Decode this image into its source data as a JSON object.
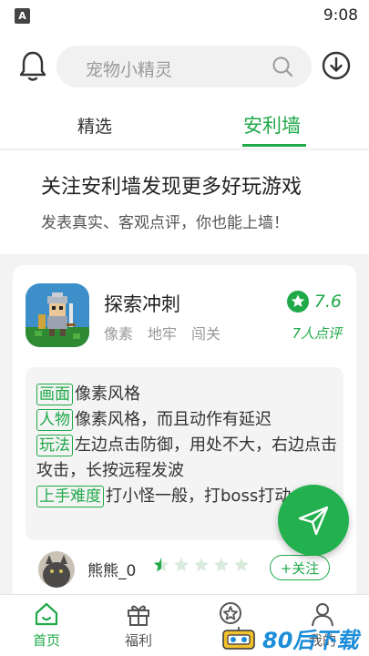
{
  "status_bar": {
    "app_icon_letter": "A",
    "time": "9:08"
  },
  "header": {
    "search_placeholder": "宠物小精灵"
  },
  "tabs": [
    {
      "label": "精选",
      "active": false
    },
    {
      "label": "安利墙",
      "active": true
    }
  ],
  "banner": {
    "title": "关注安利墙发现更多好玩游戏",
    "subtitle": "发表真实、客观点评，你也能上墙！"
  },
  "game": {
    "name": "探索冲刺",
    "tags": [
      "像素",
      "地牢",
      "闯关"
    ],
    "score": "7.6",
    "review_count": "7人点评"
  },
  "review": {
    "items": [
      {
        "tag": "画面",
        "text": "像素风格"
      },
      {
        "tag": "人物",
        "text": "像素风格，而且动作有延迟"
      },
      {
        "tag": "玩法",
        "text": "左边点击防御，用处不大，右边点击攻击，长按远程发波"
      },
      {
        "tag": "上手难度",
        "text": "打小怪一般，打boss打动..."
      }
    ],
    "reviewer_name": "熊熊_0",
    "reviewer_stars": 0.5,
    "follow_label": "+关注"
  },
  "bottom_nav": [
    {
      "label": "首页",
      "icon": "home-icon",
      "active": true
    },
    {
      "label": "福利",
      "icon": "gift-icon",
      "active": false
    },
    {
      "label": "榜",
      "icon": "rank-badge-icon",
      "active": false
    },
    {
      "label": "我的",
      "icon": "profile-icon",
      "active": false
    }
  ],
  "watermark": {
    "text": "80后下载"
  },
  "colors": {
    "accent": "#1fa949",
    "fab": "#22b14e"
  }
}
